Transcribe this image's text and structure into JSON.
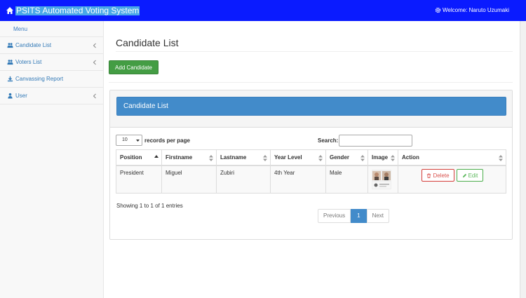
{
  "topbar": {
    "title": "PSITS Automated Voting System",
    "welcome": "Welcome: Naruto Uzumaki",
    "brand_color": "#0a1bff"
  },
  "sidebar": {
    "menu_label": "Menu",
    "items": [
      {
        "label": "Candidate List",
        "icon": "users-icon"
      },
      {
        "label": "Voters List",
        "icon": "users-icon"
      },
      {
        "label": "Canvassing Report",
        "icon": "download-icon"
      },
      {
        "label": "User",
        "icon": "user-icon"
      }
    ]
  },
  "main": {
    "page_title": "Candidate List",
    "add_button": "Add Candidate",
    "panel_title": "Candidate List",
    "length_value": "10",
    "length_label": "records per page",
    "search_label": "Search:",
    "search_value": "",
    "columns": [
      "Position",
      "Firstname",
      "Lastname",
      "Year Level",
      "Gender",
      "Image",
      "Action"
    ],
    "rows": [
      {
        "position": "President",
        "firstname": "Miguel",
        "lastname": "Zubiri",
        "year_level": "4th Year",
        "gender": "Male"
      }
    ],
    "delete_label": "Delete",
    "edit_label": "Edit",
    "info": "Showing 1 to 1 of 1 entries",
    "pager": {
      "previous": "Previous",
      "current": "1",
      "next": "Next"
    },
    "accent_color": "#428bca",
    "success_color": "#449d44",
    "danger_color": "#d9534f"
  }
}
